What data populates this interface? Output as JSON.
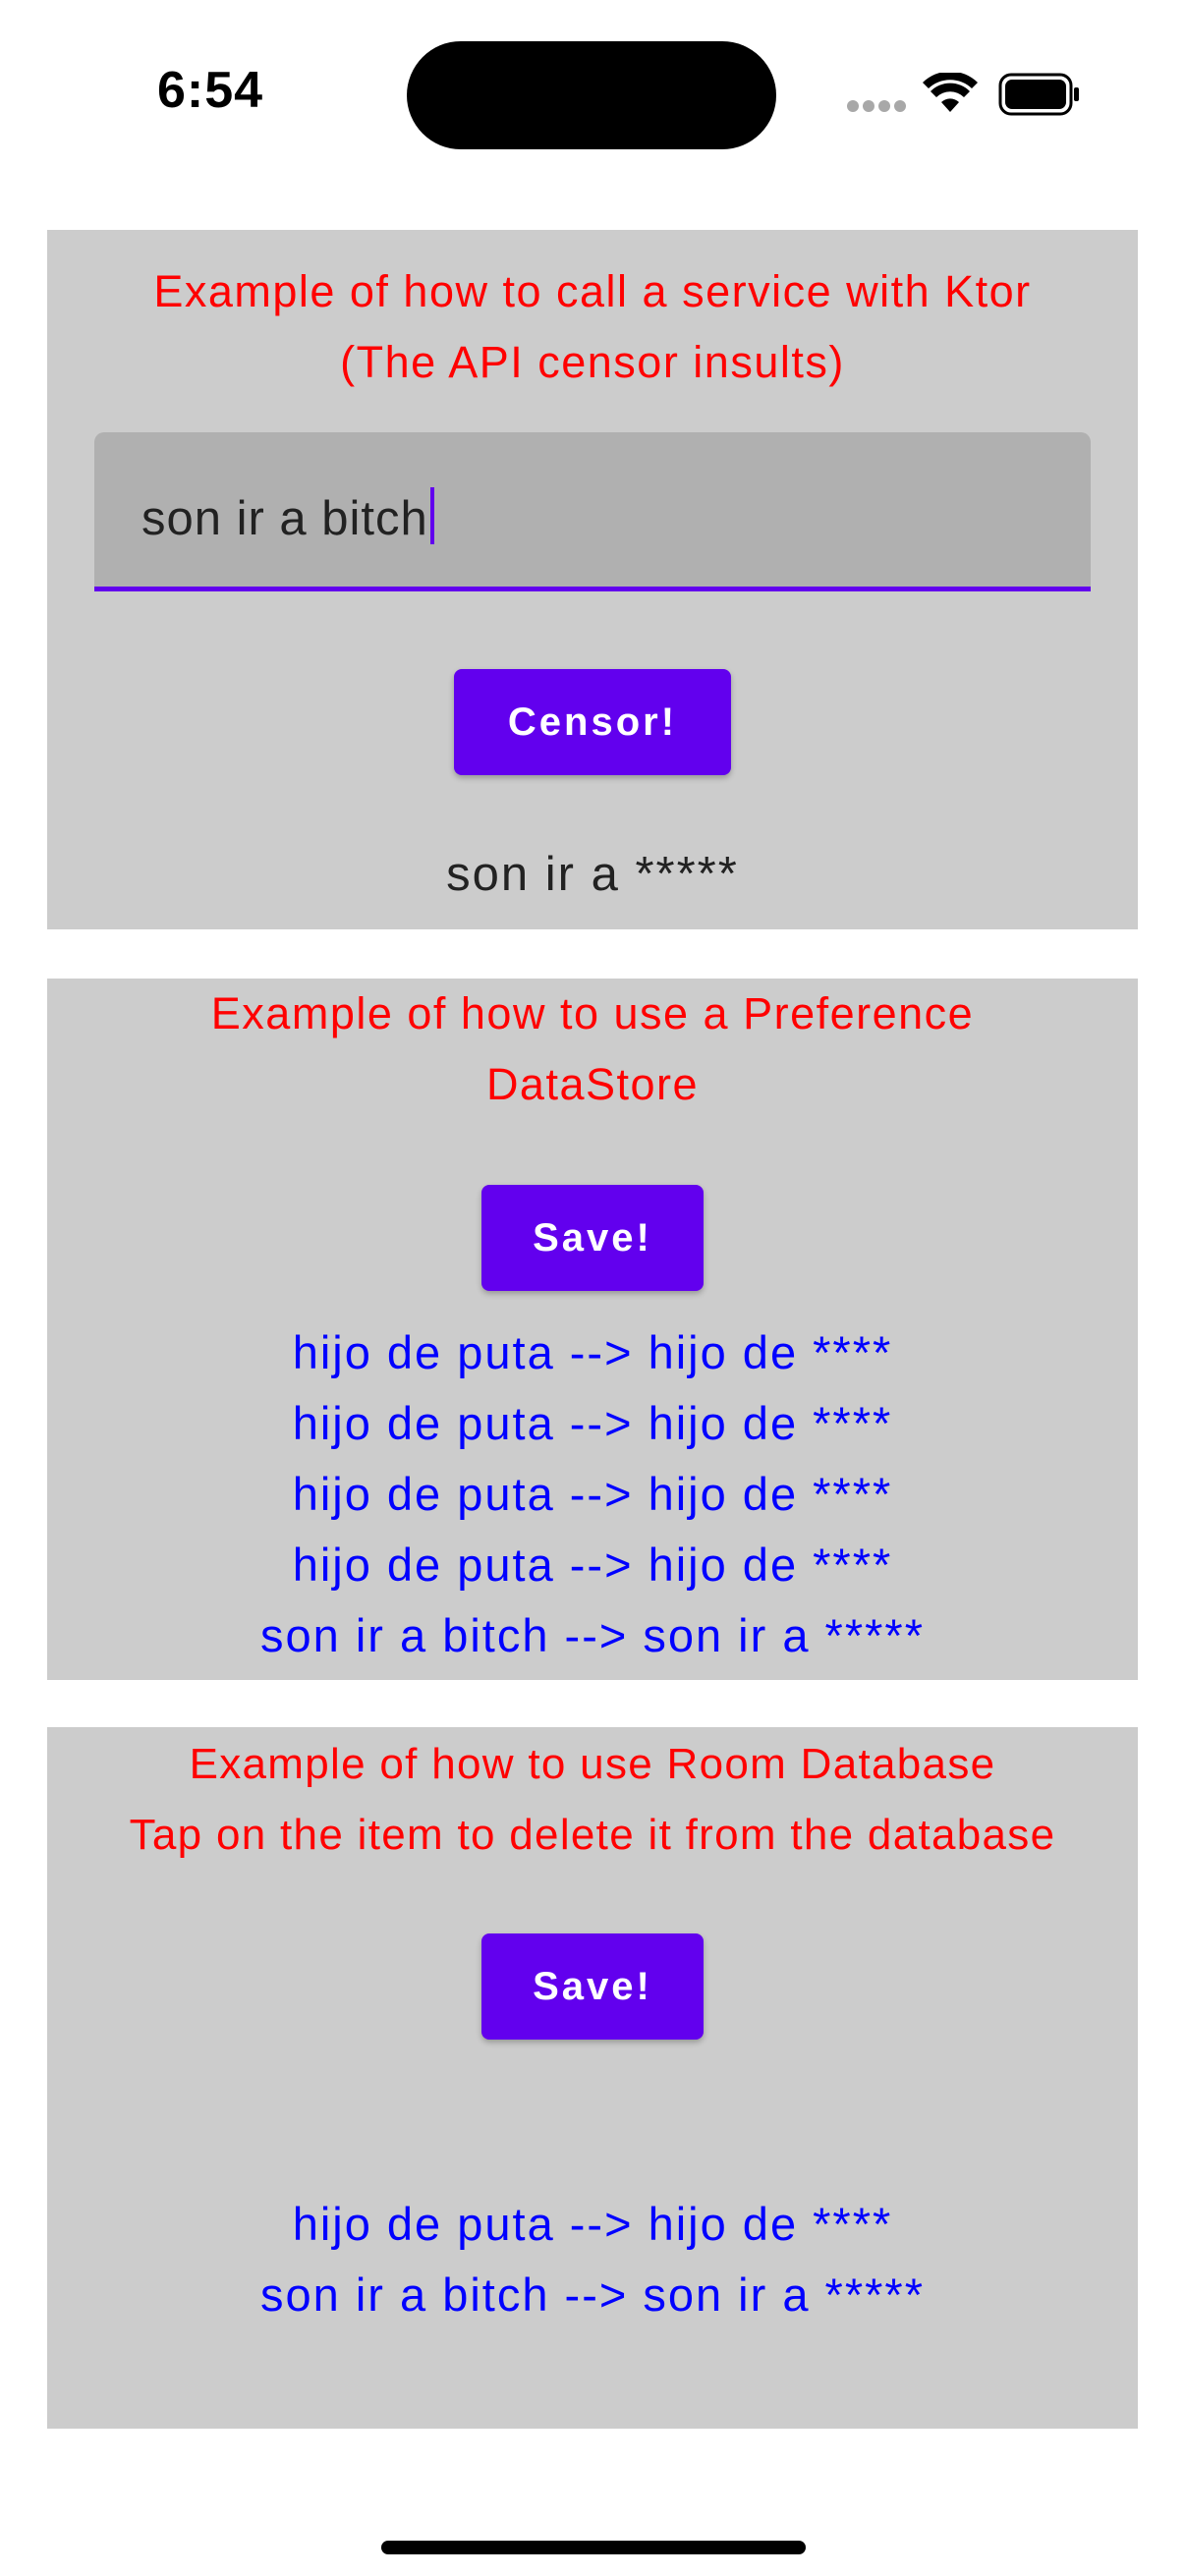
{
  "status_bar": {
    "time": "6:54"
  },
  "ktor_section": {
    "title": "Example of how to call a service with Ktor\n(The API censor insults)",
    "input_value": "son ir a bitch",
    "button_label": "Censor!",
    "result": "son ir a *****"
  },
  "datastore_section": {
    "title": "Example of how to use a Preference\nDataStore",
    "button_label": "Save!",
    "items": [
      "hijo de puta --> hijo de ****",
      "hijo de puta --> hijo de ****",
      "hijo de puta --> hijo de ****",
      "hijo de puta --> hijo de ****",
      "son ir a bitch --> son ir a *****"
    ]
  },
  "room_section": {
    "title": "Example of how to use Room Database\nTap on the item to delete it from the database",
    "button_label": "Save!",
    "items": [
      "hijo de puta --> hijo de ****",
      "son ir a bitch --> son ir a *****"
    ]
  },
  "colors": {
    "accent": "#6200ee",
    "title_red": "#ff0000",
    "item_blue": "#0000ff",
    "card_bg": "#cccccc"
  }
}
